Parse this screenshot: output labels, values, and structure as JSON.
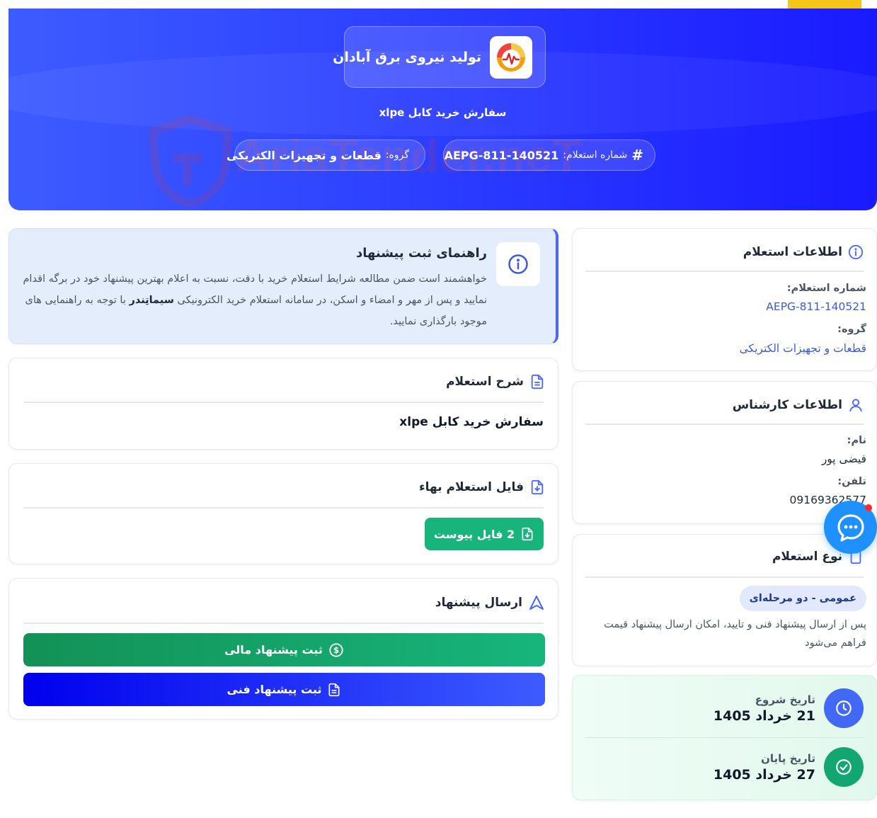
{
  "hero": {
    "brand_name": "تولید نیروی برق آبادان",
    "subtitle": "سفارش خرید کابل xlpe",
    "inquiry_label": "شماره استعلام:",
    "inquiry_number": "AEPG-811-140521",
    "group_label": "گروه:",
    "group_value": "قطعات و تجهیزات الکتریکی",
    "watermark": "AriaTender.neT"
  },
  "guide": {
    "title": "راهنمای ثبت پیشنهاد",
    "text_part1": "خواهشمند است ضمن مطالعه شرایط استعلام خرید با دقت، نسبت به اعلام بهترین پیشنهاد خود در برگه اقدام نمایید و پس از مهر و امضاء و اسکن، در سامانه استعلام خرید الکترونیکی ",
    "text_bold": "سیماتِندر",
    "text_part2": " با توجه به راهنمایی های موجود بارگذاری نمایید."
  },
  "description": {
    "title": "شرح استعلام",
    "text": "سفارش خرید کابل xlpe"
  },
  "files": {
    "title": "فایل استعلام بهاء",
    "button_label": "2 فایل پیوست"
  },
  "submit": {
    "title": "ارسال پیشنهاد",
    "financial_label": "ثبت پیشنهاد مالی",
    "technical_label": "ثبت پیشنهاد فنی"
  },
  "inquiry_info": {
    "title": "اطلاعات استعلام",
    "number_label": "شماره استعلام:",
    "number_value": "AEPG-811-140521",
    "group_label": "گروه:",
    "group_value": "قطعات و تجهیزات الکتریکی"
  },
  "expert_info": {
    "title": "اطلاعات کارشناس",
    "name_label": "نام:",
    "name_value": "فیضی پور",
    "phone_label": "تلفن:",
    "phone_value": "09169362577"
  },
  "inquiry_type": {
    "title": "نوع استعلام",
    "badge": "عمومی - دو مرحله‌ای",
    "description": "پس از ارسال پیشنهاد فنی و تایید، امکان ارسال پیشنهاد قیمت فراهم می‌شود"
  },
  "dates": {
    "start_label": "تاریخ شروع",
    "start_value": "21 خرداد 1405",
    "end_label": "تاریخ پایان",
    "end_value": "27 خرداد 1405"
  },
  "colors": {
    "hero_start": "#3d5cff",
    "hero_end": "#1a1aff",
    "accent_yellow": "#f5c518",
    "success_green": "#17b57c",
    "link_blue": "#3b5bdb",
    "chat_blue": "#1e90ff"
  }
}
